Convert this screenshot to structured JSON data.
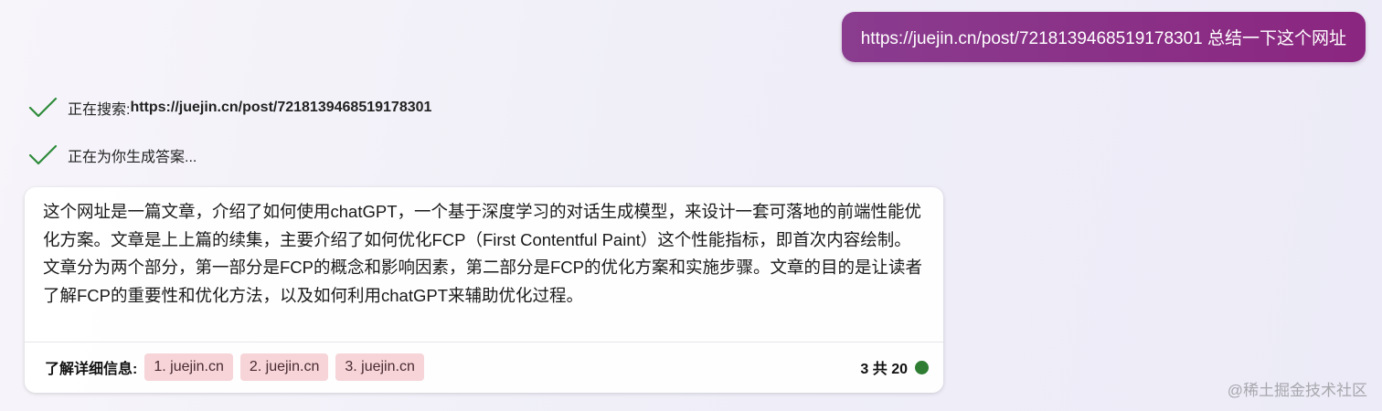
{
  "user_message": {
    "text": "https://juejin.cn/post/7218139468519178301 总结一下这个网址"
  },
  "progress": [
    {
      "label": "正在搜索: ",
      "value": "https://juejin.cn/post/7218139468519178301",
      "icon": "check-icon"
    },
    {
      "label": "正在为你生成答案...",
      "icon": "check-icon"
    }
  ],
  "answer": {
    "text": "这个网址是一篇文章，介绍了如何使用chatGPT，一个基于深度学习的对话生成模型，来设计一套可落地的前端性能优化方案。文章是上上篇的续集，主要介绍了如何优化FCP（First Contentful Paint）这个性能指标，即首次内容绘制。文章分为两个部分，第一部分是FCP的概念和影响因素，第二部分是FCP的优化方案和实施步骤。文章的目的是让读者了解FCP的重要性和优化方法，以及如何利用chatGPT来辅助优化过程。",
    "learn_more_label": "了解详细信息:",
    "sources": [
      {
        "label": "1. juejin.cn"
      },
      {
        "label": "2. juejin.cn"
      },
      {
        "label": "3. juejin.cn"
      }
    ],
    "turn_counter": "3 共 20",
    "status_color": "#2e7d32"
  },
  "watermark": "@稀土掘金技术社区",
  "colors": {
    "user_bubble": "#8a3c8f",
    "check": "#2e8b3a",
    "source_chip": "#f6d4d7"
  }
}
